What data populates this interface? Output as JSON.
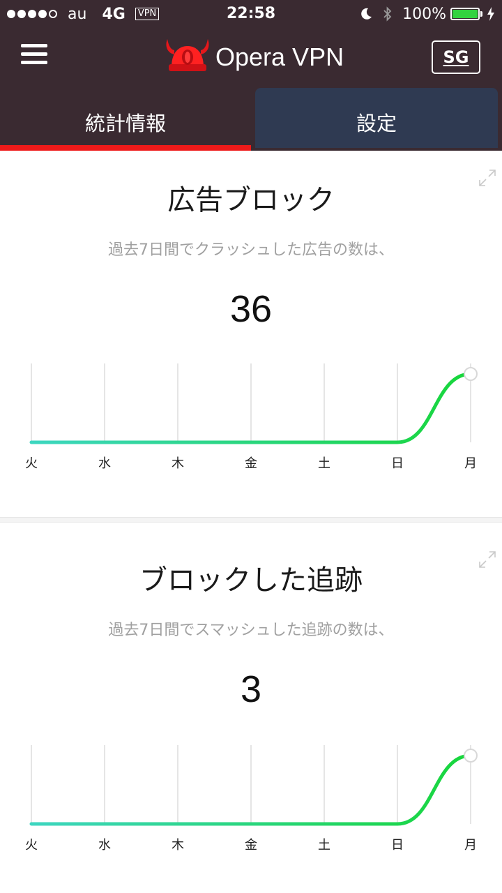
{
  "status_bar": {
    "carrier": "au",
    "network": "4G",
    "vpn": "VPN",
    "time": "22:58",
    "battery": "100%",
    "signal_dots_filled": 4,
    "signal_dots_total": 5
  },
  "header": {
    "brand": "Opera VPN",
    "region": "SG",
    "menu_icon": "hamburger-icon",
    "logo_icon": "opera-viking-helmet-logo"
  },
  "tabs": [
    {
      "label": "統計情報",
      "active": true
    },
    {
      "label": "設定",
      "active": false
    }
  ],
  "colors": {
    "header_bg": "#3a2a31",
    "active_tab_indicator": "#ee1a1a",
    "inactive_tab_bg": "#2f3a52",
    "line_start": "#3dd6c0",
    "line_end": "#17d63a"
  },
  "cards": [
    {
      "title": "広告ブロック",
      "subtitle": "過去7日間でクラッシュした広告の数は、",
      "count": "36",
      "chart_data": {
        "type": "line",
        "categories": [
          "火",
          "水",
          "木",
          "金",
          "土",
          "日",
          "月"
        ],
        "series": [
          {
            "values": [
              0,
              0,
              0,
              0,
              0,
              0,
              36
            ]
          }
        ],
        "grid": true
      }
    },
    {
      "title": "ブロックした追跡",
      "subtitle": "過去7日間でスマッシュした追跡の数は、",
      "count": "3",
      "chart_data": {
        "type": "line",
        "categories": [
          "火",
          "水",
          "木",
          "金",
          "土",
          "日",
          "月"
        ],
        "series": [
          {
            "values": [
              0,
              0,
              0,
              0,
              0,
              0,
              3
            ]
          }
        ],
        "grid": true
      }
    }
  ]
}
